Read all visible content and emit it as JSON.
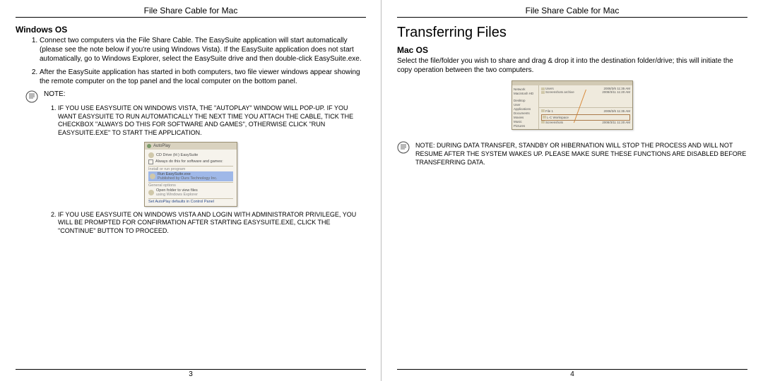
{
  "header": "File Share Cable for Mac",
  "left": {
    "heading": "Windows OS",
    "steps": [
      "Connect two computers via the File Share Cable. The EasySuite application will start automatically (please see the note below if you're using Windows Vista). If the EasySuite application does not start automatically, go to Windows Explorer, select the EasySuite drive and then double-click EasySuite.exe.",
      "After the EasySuite application has started in both computers, two file viewer windows appear showing the remote computer on the top panel and the local computer on the bottom panel."
    ],
    "note_label": "NOTE:",
    "notes": [
      "IF YOU USE EASYSUITE ON WINDOWS VISTA, THE \"AUTOPLAY\" WINDOW WILL POP-UP. IF YOU WANT EASYSUITE TO RUN AUTOMATICALLY THE NEXT TIME YOU ATTACH THE CABLE, TICK THE CHECKBOX \"ALWAYS DO THIS FOR SOFTWARE AND GAMES\", OTHERWISE CLICK \"RUN EASYSUITE.EXE\" TO START THE APPLICATION.",
      "IF YOU USE EASYSUITE ON WINDOWS VISTA AND LOGIN WITH ADMINISTRATOR PRIVILEGE, YOU WILL BE PROMPTED FOR CONFIRMATION AFTER STARTING EASYSUITE.EXE, CLICK THE \"CONTINUE\" BUTTON TO PROCEED."
    ],
    "autoplay": {
      "title": "AutoPlay",
      "drive": "CD Drive (H:) EasySuite",
      "checkbox": "Always do this for software and games:",
      "section1": "Install or run program",
      "run": "Run EasySuite.exe",
      "publisher": "Published by Ours Technology Inc.",
      "section2": "General options",
      "open": "Open folder to view files",
      "using": "using Windows Explorer",
      "link": "Set AutoPlay defaults in Control Panel"
    },
    "page_num": "3"
  },
  "right": {
    "title": "Transferring Files",
    "heading": "Mac OS",
    "para": "Select the file/folder you wish to share and drag & drop it into the destination folder/drive; this will initiate the copy operation between the two computers.",
    "mac_ui": {
      "side": [
        "Network",
        "Macintosh HD",
        "Desktop",
        "User",
        "Applications",
        "Documents",
        "Movies",
        "Music",
        "Pictures"
      ],
      "top_items": [
        "Users",
        "Screenshots archive"
      ],
      "dates": [
        "2008/3/6 11:35 AM",
        "2008/3/11 11:20 AM"
      ],
      "bottom_items": [
        "File 1",
        "L-C Workspace",
        "Screenshots"
      ]
    },
    "note": "NOTE: DURING DATA TRANSFER, STANDBY OR HIBERNATION WILL STOP THE PROCESS AND WILL NOT RESUME AFTER THE SYSTEM WAKES UP. PLEASE MAKE SURE THESE FUNCTIONS ARE DISABLED BEFORE TRANSFERRING DATA.",
    "page_num": "4"
  }
}
